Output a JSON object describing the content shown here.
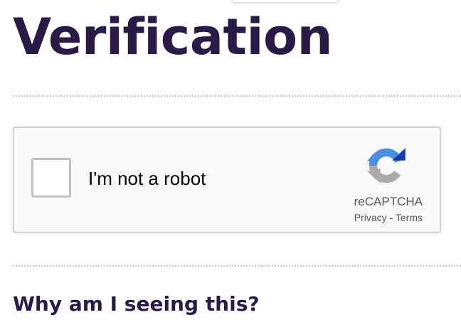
{
  "page": {
    "title": "Verification"
  },
  "captcha": {
    "checkbox_label": "I'm not a robot",
    "checked": false,
    "brand_name": "reCAPTCHA",
    "privacy_link": "Privacy",
    "link_separator": " - ",
    "terms_link": "Terms",
    "logo_icon": "recaptcha-logo-icon",
    "colors": {
      "blue": "#4a90e2",
      "dark_blue": "#1c3aa9",
      "gray": "#ababab"
    }
  },
  "help": {
    "heading": "Why am I seeing this?"
  },
  "theme": {
    "heading_color": "#2a1a47",
    "divider_color": "#c9c9c9"
  }
}
